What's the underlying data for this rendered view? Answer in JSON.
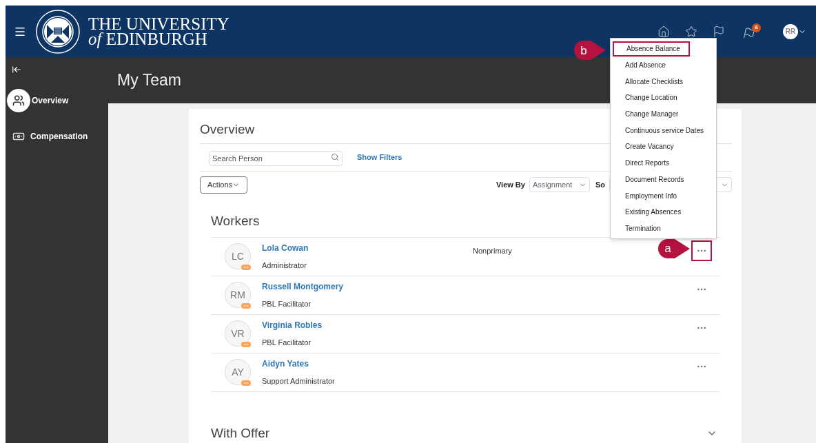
{
  "header": {
    "logo_line1": "THE UNIVERSITY",
    "logo_of": "of",
    "logo_line2": "EDINBURGH",
    "notification_count": "6",
    "user_initials": "RR"
  },
  "page_title": "My Team",
  "sidebar": {
    "items": [
      {
        "label": "Overview",
        "kind": "team",
        "selected": true
      },
      {
        "label": "Compensation",
        "kind": "money",
        "selected": false
      }
    ]
  },
  "overview": {
    "title": "Overview",
    "search": {
      "placeholder": "Search Person"
    },
    "show_filters": "Show Filters",
    "actions": "Actions",
    "view_by": {
      "label": "View By",
      "value": "Assignment"
    },
    "sort_by": {
      "label": "So"
    }
  },
  "workers": {
    "title": "Workers",
    "rows": [
      {
        "initials": "LC",
        "name": "Lola Cowan",
        "role": "Administrator",
        "assignment": "Nonprimary",
        "highlighted": true,
        "callout": "a"
      },
      {
        "initials": "RM",
        "name": "Russell Montgomery",
        "role": "PBL Facilitator",
        "highlighted": false
      },
      {
        "initials": "VR",
        "name": "Virginia Robles",
        "role": "PBL Facilitator",
        "highlighted": false
      },
      {
        "initials": "AY",
        "name": "Aidyn Yates",
        "role": "Support Administrator",
        "highlighted": false
      }
    ]
  },
  "with_offer": {
    "title": "With Offer",
    "expanded": false
  },
  "actions_menu": {
    "items": [
      {
        "label": "Absence Balance",
        "highlighted": true,
        "callout": "b"
      },
      {
        "label": "Add Absence",
        "highlighted": false
      },
      {
        "label": "Allocate Checklists",
        "highlighted": false
      },
      {
        "label": "Change Location",
        "highlighted": false
      },
      {
        "label": "Change Manager",
        "highlighted": false
      },
      {
        "label": "Continuous service Dates",
        "highlighted": false
      },
      {
        "label": "Create Vacancy",
        "highlighted": false
      },
      {
        "label": "Direct Reports",
        "highlighted": false
      },
      {
        "label": "Document Records",
        "highlighted": false
      },
      {
        "label": "Employment Info",
        "highlighted": false
      },
      {
        "label": "Existing Absences",
        "highlighted": false
      },
      {
        "label": "Termination",
        "highlighted": false
      }
    ]
  }
}
